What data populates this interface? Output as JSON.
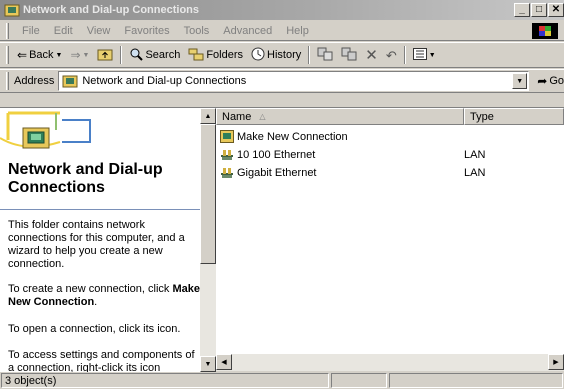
{
  "window": {
    "title": "Network and Dial-up Connections"
  },
  "window_buttons": {
    "minimize": "_",
    "maximize": "□",
    "close": "✕"
  },
  "menu": [
    "File",
    "Edit",
    "View",
    "Favorites",
    "Tools",
    "Advanced",
    "Help"
  ],
  "toolbar": {
    "back_label": "Back",
    "search_label": "Search",
    "folders_label": "Folders",
    "history_label": "History"
  },
  "address": {
    "label": "Address",
    "value": "Network and Dial-up Connections",
    "go_label": "Go"
  },
  "left_pane": {
    "title": "Network and Dial-up Connections",
    "intro": "This folder contains network connections for this computer, and a wizard to help you create a new connection.",
    "create_prefix": "To create a new connection, click",
    "create_link": "Make New Connection",
    "create_suffix": ".",
    "open_text": "To open a connection, click its icon.",
    "access_text": "To access settings and components of a connection, right-click its icon"
  },
  "list": {
    "columns": [
      "Name",
      "Type"
    ],
    "rows": [
      {
        "name": "Make New Connection",
        "type": "",
        "icon": "wizard-icon"
      },
      {
        "name": "10 100 Ethernet",
        "type": "LAN",
        "icon": "lan-connection-icon"
      },
      {
        "name": "Gigabit Ethernet",
        "type": "LAN",
        "icon": "lan-connection-icon"
      }
    ]
  },
  "status": {
    "text": "3 object(s)"
  },
  "colors": {
    "title_gradient_start": "#8a8a8a",
    "face": "#d4d0c8",
    "accent_blue": "#2a4f9e"
  }
}
